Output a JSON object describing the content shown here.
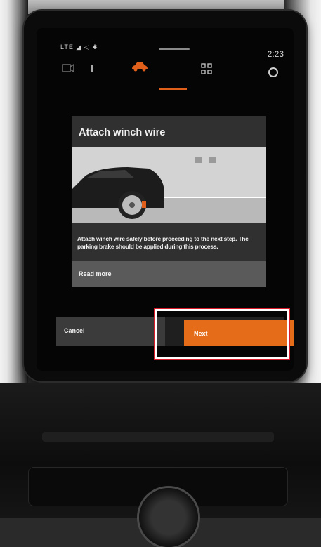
{
  "status_bar": {
    "signal_text": "LTE",
    "clock": "2:23"
  },
  "top_icons": [
    "camera-icon",
    "car-icon",
    "apps-grid-icon",
    "home-circle-icon"
  ],
  "dialog": {
    "title": "Attach winch wire",
    "body": "Attach winch wire safely before proceeding to the next step. The parking brake should be applied during this process.",
    "read_more_label": "Read more"
  },
  "footer": {
    "cancel_label": "Cancel",
    "next_label": "Next"
  },
  "colors": {
    "accent": "#e56d1a",
    "highlight_border": "#d81c2a",
    "dialog_bg": "#303030"
  }
}
